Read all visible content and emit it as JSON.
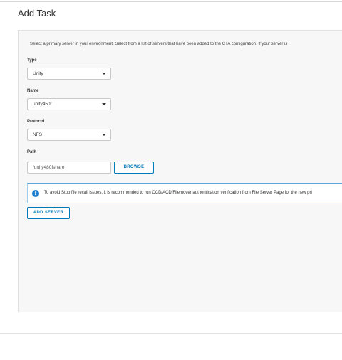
{
  "dialog": {
    "title": "Add Task"
  },
  "intro_text": "Select a primary server in your environment. Select from a list of servers that have been added to the CTA configuration. If your server is",
  "fields": {
    "type": {
      "label": "Type",
      "value": "Unity"
    },
    "name": {
      "label": "Name",
      "value": "unity450f"
    },
    "protocol": {
      "label": "Protocol",
      "value": "NFS"
    },
    "path": {
      "label": "Path",
      "value": "/unity480fshare"
    }
  },
  "buttons": {
    "browse": "BROWSE",
    "add_server": "ADD SERVER"
  },
  "alert": {
    "icon": "info-icon",
    "text": "To avoid Stub file recall issues, it is recommended to run CCD/ACD/Filemover authentication verification from File Server Page for the new pri"
  },
  "colors": {
    "accent": "#0079b8",
    "info": "#1e7ecf",
    "panel_bg": "#f7f7f7"
  }
}
